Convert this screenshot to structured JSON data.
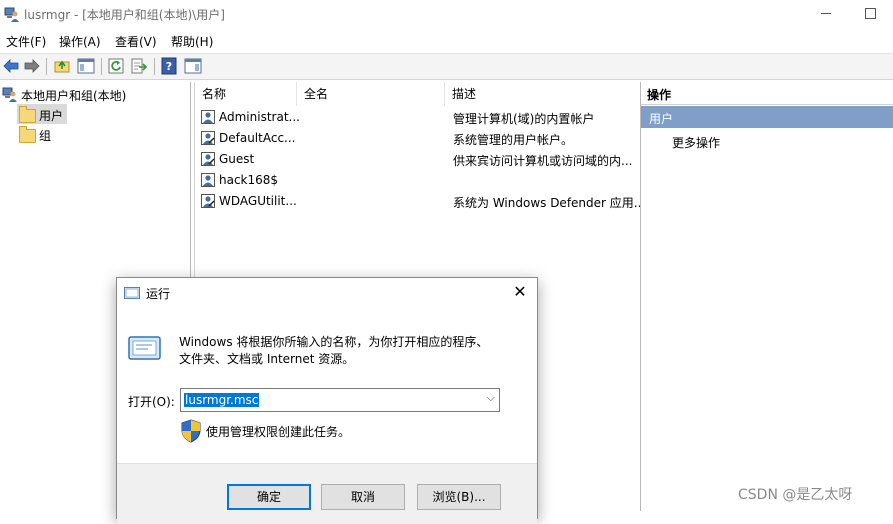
{
  "window": {
    "title": "lusrmgr - [本地用户和组(本地)\\用户]"
  },
  "menu": {
    "items": [
      "文件(F)",
      "操作(A)",
      "查看(V)",
      "帮助(H)"
    ]
  },
  "toolbar": {
    "icons": [
      "back-arrow-icon",
      "forward-arrow-icon",
      "up-folder-icon",
      "show-hide-tree-icon",
      "refresh-icon",
      "export-list-icon",
      "help-icon",
      "show-hide-action-pane-icon"
    ]
  },
  "tree": {
    "root": "本地用户和组(本地)",
    "items": [
      "用户",
      "组"
    ]
  },
  "list": {
    "columns": [
      "名称",
      "全名",
      "描述"
    ],
    "rows": [
      {
        "name": "Administrat...",
        "full_name": "",
        "description": "管理计算机(域)的内置帐户"
      },
      {
        "name": "DefaultAcc...",
        "full_name": "",
        "description": "系统管理的用户帐户。"
      },
      {
        "name": "Guest",
        "full_name": "",
        "description": "供来宾访问计算机或访问域的内..."
      },
      {
        "name": "hack168$",
        "full_name": "",
        "description": ""
      },
      {
        "name": "WDAGUtilit...",
        "full_name": "",
        "description": "系统为 Windows Defender 应用..."
      }
    ]
  },
  "actions": {
    "header": "操作",
    "selected": "用户",
    "more": "更多操作"
  },
  "run_dialog": {
    "title": "运行",
    "description_line1": "Windows 将根据你所输入的名称，为你打开相应的程序、",
    "description_line2": "文件夹、文档或 Internet 资源。",
    "open_label": "打开(O):",
    "input_value": "lusrmgr.msc",
    "admin_note": "使用管理权限创建此任务。",
    "ok_label": "确定",
    "cancel_label": "取消",
    "browse_label": "浏览(B)..."
  },
  "watermark": "CSDN @是乙太呀",
  "colors": {
    "selection_blue": "#0078d7",
    "action_highlight": "#7f9fc8",
    "folder_yellow": "#f6d87a"
  }
}
